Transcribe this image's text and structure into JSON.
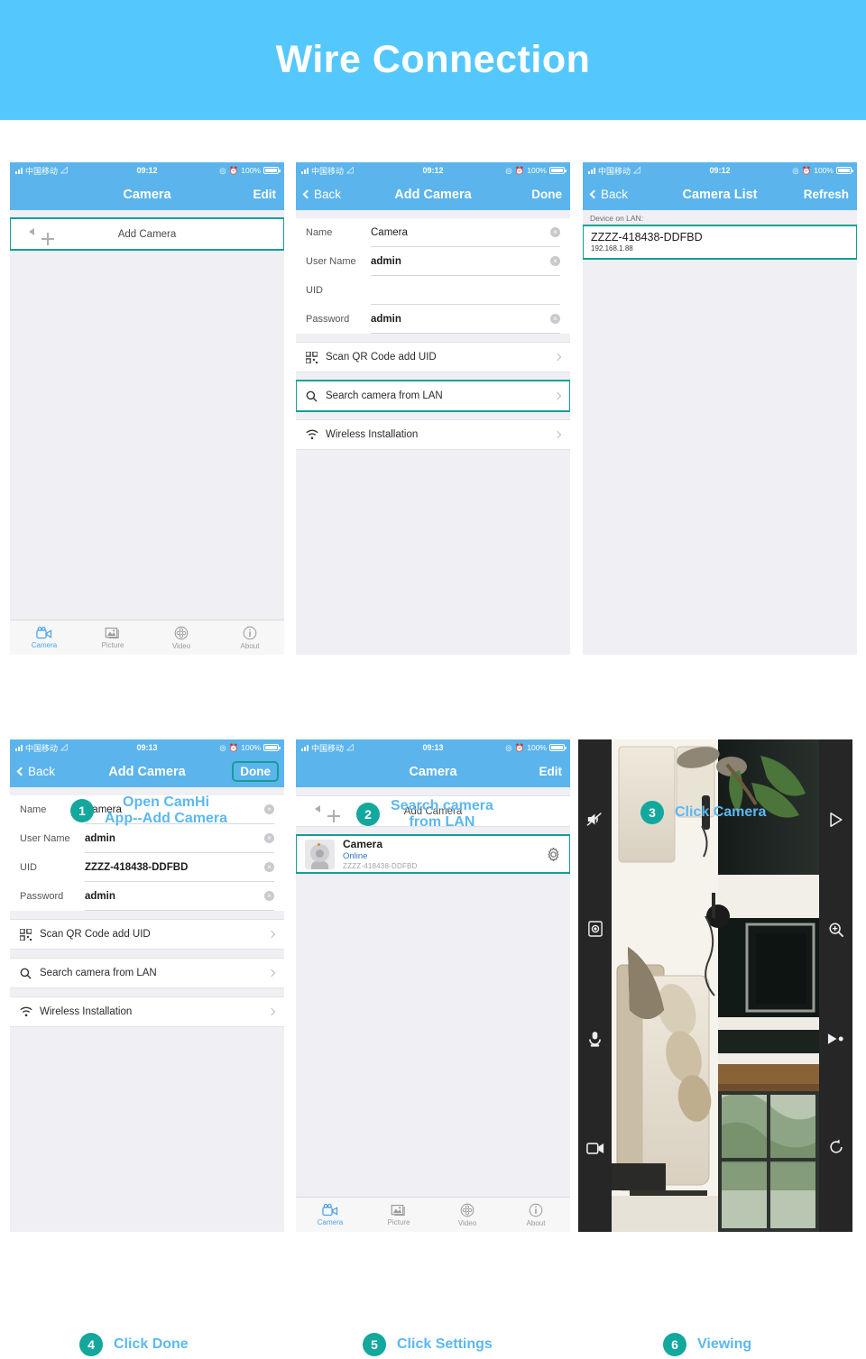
{
  "banner": {
    "title": "Wire Connection"
  },
  "status_bar": {
    "carrier": "中国移动",
    "wifi_icon": "wifi-icon",
    "time_912": "09:12",
    "time_913": "09:13",
    "battery_percent": "100%",
    "location_icon": "location-arrow-icon",
    "alarm_icon": "alarm-clock-icon"
  },
  "colors": {
    "banner_blue": "#54c8fd",
    "nav_blue": "#5bb4ec",
    "teal": "#14a79d",
    "highlight_teal": "#12a094",
    "caption_blue": "#5cb8f0",
    "screen_gray": "#efeff4",
    "online_blue": "#2f72c4"
  },
  "tabbar": {
    "tabs": [
      {
        "label": "Camera",
        "icon": "video-camera-icon",
        "active": true
      },
      {
        "label": "Picture",
        "icon": "photo-icon",
        "active": false
      },
      {
        "label": "Video",
        "icon": "film-reel-icon",
        "active": false
      },
      {
        "label": "About",
        "icon": "info-circle-icon",
        "active": false
      }
    ]
  },
  "phone1": {
    "nav": {
      "left": "",
      "title": "Camera",
      "right": "Edit"
    },
    "add_camera": {
      "label": "Add Camera",
      "icon": "camera-plus-icon",
      "highlighted": true
    }
  },
  "phone2": {
    "nav": {
      "back": "Back",
      "title": "Add Camera",
      "right": "Done"
    },
    "fields": [
      {
        "label": "Name",
        "value": "Camera",
        "bold": false,
        "clearable": true
      },
      {
        "label": "User Name",
        "value": "admin",
        "bold": true,
        "clearable": true
      },
      {
        "label": "UID",
        "value": "",
        "bold": false,
        "clearable": false
      },
      {
        "label": "Password",
        "value": "admin",
        "bold": true,
        "clearable": true
      }
    ],
    "rows": [
      {
        "label": "Scan QR Code add UID",
        "icon": "qr-code-icon",
        "highlighted": false
      },
      {
        "label": "Search camera from LAN",
        "icon": "search-icon",
        "highlighted": true
      },
      {
        "label": "Wireless Installation",
        "icon": "wifi-icon",
        "highlighted": false
      }
    ]
  },
  "phone3": {
    "nav": {
      "back": "Back",
      "title": "Camera List",
      "right": "Refresh"
    },
    "section_header": "Device on LAN:",
    "device": {
      "uid": "ZZZZ-418438-DDFBD",
      "ip": "192.168.1.88",
      "highlighted": true
    }
  },
  "phone4": {
    "nav": {
      "back": "Back",
      "title": "Add Camera",
      "right": "Done",
      "right_highlighted": true
    },
    "fields": [
      {
        "label": "Name",
        "value": "Camera",
        "bold": false,
        "clearable": true
      },
      {
        "label": "User Name",
        "value": "admin",
        "bold": true,
        "clearable": true
      },
      {
        "label": "UID",
        "value": "ZZZZ-418438-DDFBD",
        "bold": true,
        "clearable": true
      },
      {
        "label": "Password",
        "value": "admin",
        "bold": true,
        "clearable": true
      }
    ],
    "rows": [
      {
        "label": "Scan QR Code add UID",
        "icon": "qr-code-icon",
        "highlighted": false
      },
      {
        "label": "Search camera from LAN",
        "icon": "search-icon",
        "highlighted": false
      },
      {
        "label": "Wireless Installation",
        "icon": "wifi-icon",
        "highlighted": false
      }
    ]
  },
  "phone5": {
    "nav": {
      "left": "",
      "title": "Camera",
      "right": "Edit"
    },
    "add_camera": {
      "label": "Add Camera",
      "icon": "camera-plus-icon",
      "highlighted": false
    },
    "camera_entry": {
      "name": "Camera",
      "status": "Online",
      "uid": "ZZZZ-418438-DDFBD",
      "settings_icon": "gear-icon",
      "highlighted": true
    }
  },
  "phone6": {
    "left_controls": [
      {
        "icon": "mute-speaker-icon"
      },
      {
        "icon": "snapshot-camera-icon"
      },
      {
        "icon": "microphone-icon"
      },
      {
        "icon": "record-video-icon"
      }
    ],
    "right_controls": [
      {
        "icon": "play-triangle-icon"
      },
      {
        "icon": "zoom-in-icon"
      },
      {
        "icon": "fast-forward-icon"
      },
      {
        "icon": "rotate-icon"
      }
    ]
  },
  "steps": [
    {
      "number": "1",
      "text": "Open CamHi\nApp--Add Camera",
      "align": "center"
    },
    {
      "number": "2",
      "text": "Search camera\nfrom LAN",
      "align": "center"
    },
    {
      "number": "3",
      "text": "Click Camera",
      "align": "left"
    },
    {
      "number": "4",
      "text": "Click Done",
      "align": "left"
    },
    {
      "number": "5",
      "text": "Click Settings",
      "align": "left"
    },
    {
      "number": "6",
      "text": "Viewing",
      "align": "left"
    }
  ]
}
